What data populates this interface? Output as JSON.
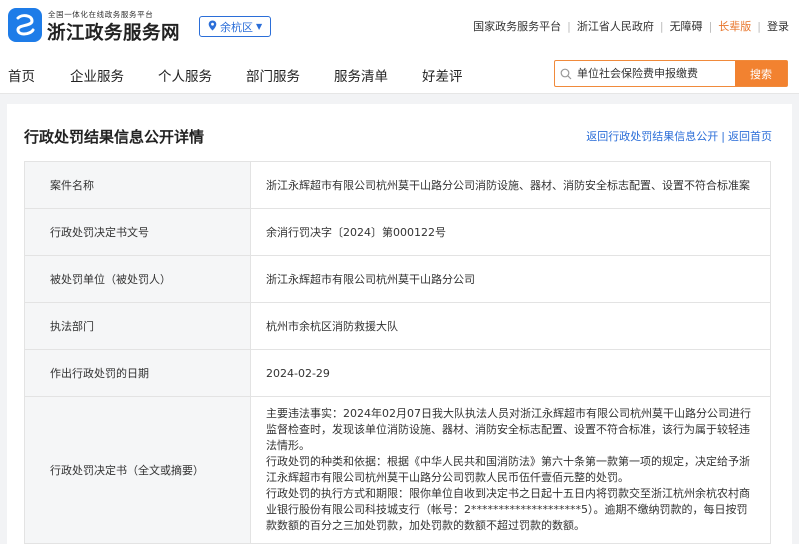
{
  "header": {
    "tagline": "全国一体化在线政务服务平台",
    "brand": "浙江政务服务网",
    "region": "余杭区",
    "toplinks": [
      "国家政务服务平台",
      "浙江省人民政府",
      "无障碍",
      "长辈版",
      "登录"
    ]
  },
  "nav": {
    "items": [
      "首页",
      "企业服务",
      "个人服务",
      "部门服务",
      "服务清单",
      "好差评"
    ],
    "search_placeholder": "单位社会保险费申报缴费",
    "search_button": "搜索"
  },
  "page": {
    "title": "行政处罚结果信息公开详情",
    "back_list": "返回行政处罚结果信息公开",
    "back_home": "返回首页"
  },
  "details": [
    {
      "label": "案件名称",
      "value": "浙江永辉超市有限公司杭州莫干山路分公司消防设施、器材、消防安全标志配置、设置不符合标准案"
    },
    {
      "label": "行政处罚决定书文号",
      "value": "余消行罚决字〔2024〕第000122号"
    },
    {
      "label": "被处罚单位（被处罚人）",
      "value": "浙江永辉超市有限公司杭州莫干山路分公司"
    },
    {
      "label": "执法部门",
      "value": "杭州市余杭区消防救援大队"
    },
    {
      "label": "作出行政处罚的日期",
      "value": "2024-02-29"
    }
  ],
  "decision": {
    "label": "行政处罚决定书（全文或摘要）",
    "paragraphs": [
      "主要违法事实：2024年02月07日我大队执法人员对浙江永辉超市有限公司杭州莫干山路分公司进行监督检查时，发现该单位消防设施、器材、消防安全标志配置、设置不符合标准，该行为属于较轻违法情形。",
      "行政处罚的种类和依据：根据《中华人民共和国消防法》第六十条第一款第一项的规定，决定给予浙江永辉超市有限公司杭州莫干山路分公司罚款人民币伍仟壹佰元整的处罚。",
      "行政处罚的执行方式和期限：限你单位自收到决定书之日起十五日内将罚款交至浙江杭州余杭农村商业银行股份有限公司科技城支行（帐号：2********************5）。逾期不缴纳罚款的，每日按罚款数额的百分之三加处罚款，加处罚款的数额不超过罚款的数额。"
    ]
  },
  "colors": {
    "accent": "#2b6ed8",
    "search_orange": "#f28230",
    "elder_orange": "#e8762c"
  }
}
